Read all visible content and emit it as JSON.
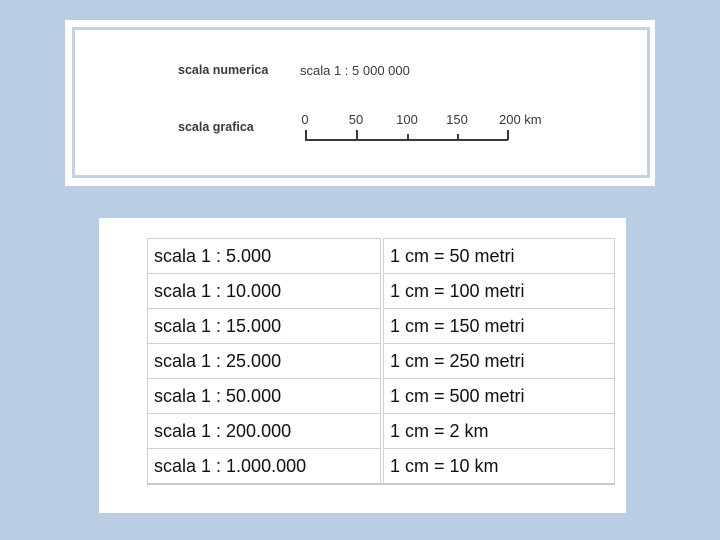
{
  "top_panel": {
    "numeric_label": "scala numerica",
    "numeric_value": "scala 1 : 5 000 000",
    "graphic_label": "scala grafica",
    "graphic_scale": {
      "ticks": [
        "0",
        "50",
        "100",
        "150",
        "200 km"
      ]
    }
  },
  "table": {
    "rows": [
      {
        "scale": "scala 1 : 5.000",
        "equivalence": "1 cm = 50 metri"
      },
      {
        "scale": "scala 1 : 10.000",
        "equivalence": "1 cm = 100 metri"
      },
      {
        "scale": "scala 1 : 15.000",
        "equivalence": "1 cm = 150 metri"
      },
      {
        "scale": "scala 1 : 25.000",
        "equivalence": "1 cm = 250 metri"
      },
      {
        "scale": "scala 1 : 50.000",
        "equivalence": "1 cm = 500 metri"
      },
      {
        "scale": "scala 1 : 200.000",
        "equivalence": "1 cm = 2 km"
      },
      {
        "scale": "scala 1 : 1.000.000",
        "equivalence": "1 cm = 10 km"
      }
    ]
  }
}
